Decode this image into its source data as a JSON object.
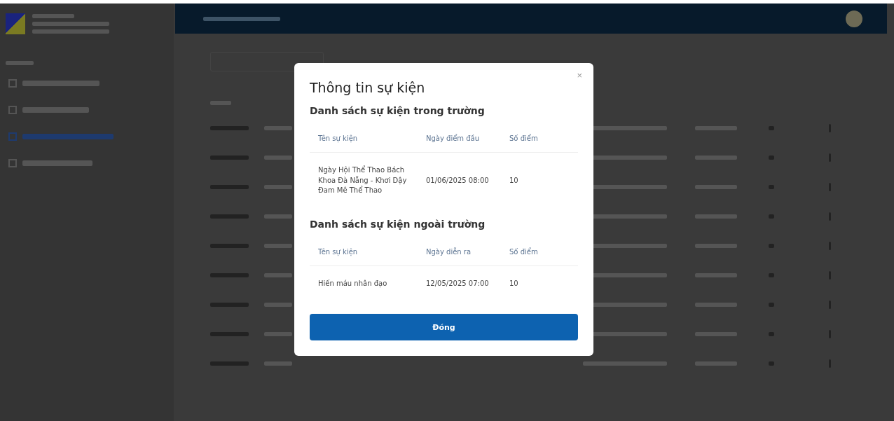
{
  "dialog": {
    "title": "Thông tin sự kiện",
    "close_label": "×",
    "sections": [
      {
        "heading": "Danh sách sự kiện trong trường",
        "columns": [
          "Tên sự kiện",
          "Ngày điểm đầu",
          "Số điểm"
        ],
        "rows": [
          {
            "name": "Ngày Hội Thể Thao Bách Khoa Đà Nẵng - Khơi Dậy Đam Mê Thể Thao",
            "date": "01/06/2025 08:00",
            "points": "10"
          }
        ]
      },
      {
        "heading": "Danh sách sự kiện ngoài trường",
        "columns": [
          "Tên sự kiện",
          "Ngày diễn ra",
          "Số điểm"
        ],
        "rows": [
          {
            "name": "Hiến máu nhân đạo",
            "date": "12/05/2025 07:00",
            "points": "10"
          }
        ]
      }
    ],
    "button": "Đóng"
  }
}
